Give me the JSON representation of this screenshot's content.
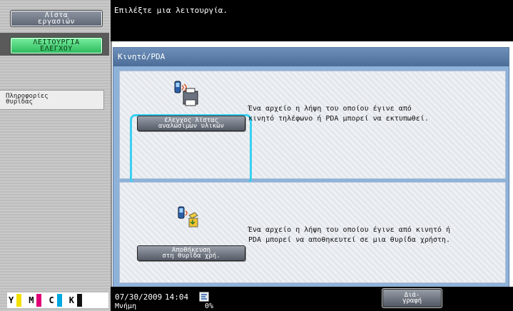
{
  "sidebar": {
    "job_list_label": "Λίστα\nεργασιών",
    "utility_label": "ΛΕΙΤΟΥΡΓΙΑ\nΕΛΕΓΧΟΥ",
    "box_info_label": "Πληροφορίες\nθυρίδας"
  },
  "toner": {
    "items": [
      {
        "letter": "Y",
        "color": "#f2e100"
      },
      {
        "letter": "M",
        "color": "#e0007a"
      },
      {
        "letter": "C",
        "color": "#00a8e0"
      },
      {
        "letter": "K",
        "color": "#111111"
      }
    ]
  },
  "header": {
    "message": "Επιλέξτε μια λειτουργία."
  },
  "panel": {
    "title": "Κινητό/PDA",
    "functions": [
      {
        "button_label": "έλεγχος λίστας\nαναλώσιμων υλικών",
        "description": "Ένα αρχείο η λήψη του οποίου έγινε από\nκινητό τηλέφωνο ή PDA μπορεί να εκτυπωθεί.",
        "icon": "mobile-print-icon",
        "selected": true
      },
      {
        "button_label": "Αποθήκευση\nστη θυρίδα χρή.",
        "description": "Ένα αρχείο η λήψη του οποίου έγινε από κινητό ή\nPDA μπορεί να αποθηκευτεί σε μια θυρίδα χρήστη.",
        "icon": "mobile-to-box-icon",
        "selected": false
      }
    ]
  },
  "status": {
    "date": "07/30/2009",
    "time": "14:04",
    "memory_label": "Μνήμη",
    "memory_value": "0%",
    "network_icon": "network-icon",
    "exit_label": "Διά-\nγραφή"
  },
  "colors": {
    "accent_selection": "#39d0f0",
    "panel_bg": "#8fb2d9",
    "utility_green": "#2ab85a"
  }
}
